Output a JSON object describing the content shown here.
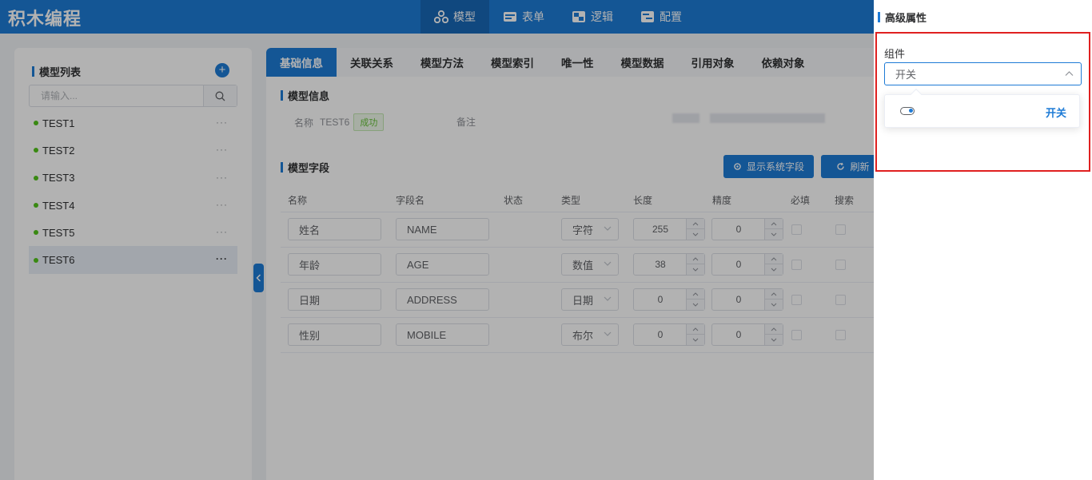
{
  "app": {
    "title": "积木编程"
  },
  "nav": [
    {
      "label": "模型",
      "icon": "model-icon",
      "active": true
    },
    {
      "label": "表单",
      "icon": "form-icon",
      "active": false
    },
    {
      "label": "逻辑",
      "icon": "logic-icon",
      "active": false
    },
    {
      "label": "配置",
      "icon": "config-icon",
      "active": false
    }
  ],
  "sidebar": {
    "title": "模型列表",
    "search_placeholder": "请输入...",
    "items": [
      {
        "label": "TEST1"
      },
      {
        "label": "TEST2"
      },
      {
        "label": "TEST3"
      },
      {
        "label": "TEST4"
      },
      {
        "label": "TEST5"
      },
      {
        "label": "TEST6",
        "active": true
      }
    ],
    "more": "···"
  },
  "tabs": [
    "基础信息",
    "关联关系",
    "模型方法",
    "模型索引",
    "唯一性",
    "模型数据",
    "引用对象",
    "依赖对象"
  ],
  "model_info": {
    "title": "模型信息",
    "name_label": "名称",
    "name_value": "TEST6",
    "status": "成功",
    "remark_label": "备注"
  },
  "fields": {
    "title": "模型字段",
    "show_system_button": "显示系统字段",
    "refresh_button": "刷新",
    "columns": [
      "名称",
      "字段名",
      "状态",
      "类型",
      "长度",
      "精度",
      "必填",
      "搜索"
    ],
    "rows": [
      {
        "name": "姓名",
        "field": "NAME",
        "type": "字符",
        "length": "255",
        "precision": "0"
      },
      {
        "name": "年龄",
        "field": "AGE",
        "type": "数值",
        "length": "38",
        "precision": "0"
      },
      {
        "name": "日期",
        "field": "ADDRESS",
        "type": "日期",
        "length": "0",
        "precision": "0"
      },
      {
        "name": "性别",
        "field": "MOBILE",
        "type": "布尔",
        "length": "0",
        "precision": "0"
      }
    ]
  },
  "drawer": {
    "title": "高级属性",
    "component_label": "组件",
    "component_value": "开关",
    "option_label": "开关"
  },
  "colors": {
    "primary": "#1e7bd6",
    "success": "#67c23a",
    "highlight": "#e02020"
  }
}
